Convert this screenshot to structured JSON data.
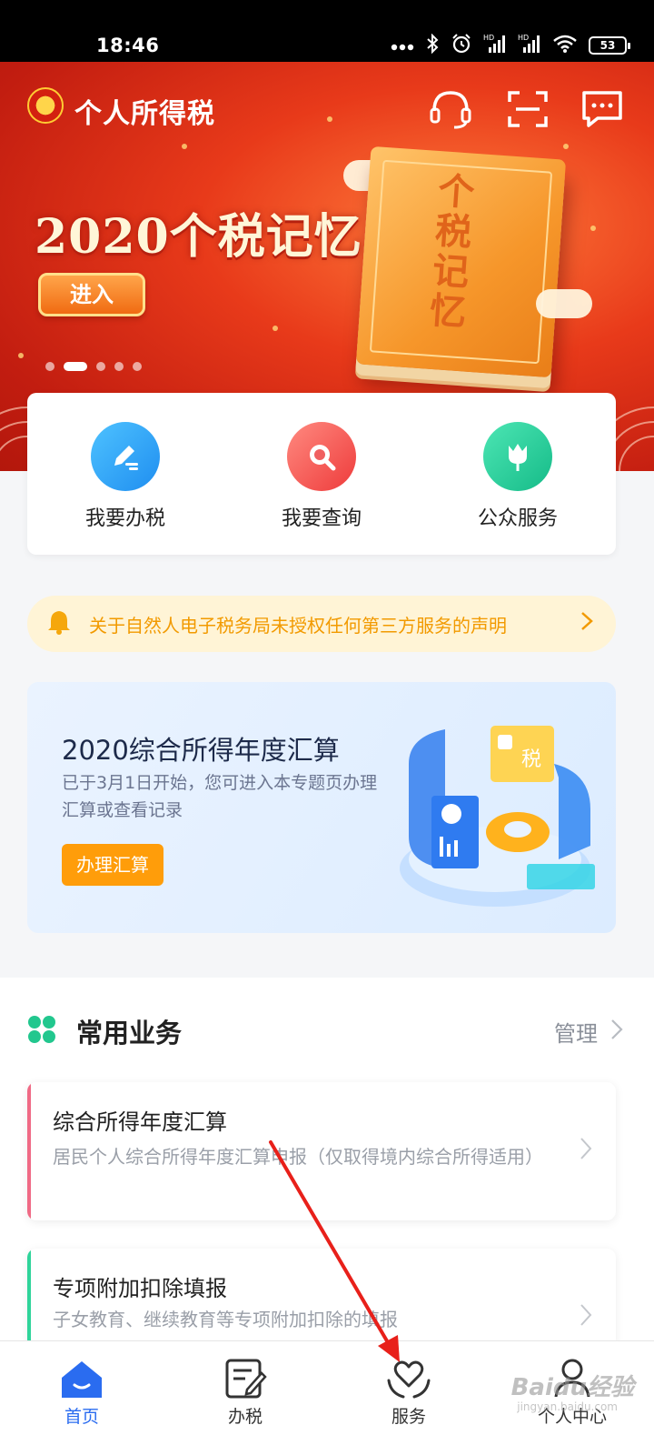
{
  "status_bar": {
    "time": "18:46",
    "battery": "53",
    "hd1": "HD",
    "hd2": "HD"
  },
  "header": {
    "app_title": "个人所得税"
  },
  "banner": {
    "title": "2020个税记忆",
    "enter_label": "进入",
    "book_text": "个税记忆",
    "page_count": 5,
    "active_page": 2
  },
  "quick_actions": [
    {
      "label": "我要办税",
      "icon": "edit-icon",
      "color": "#2aa3f5"
    },
    {
      "label": "我要查询",
      "icon": "search-icon",
      "color": "#f0494a"
    },
    {
      "label": "公众服务",
      "icon": "tulip-icon",
      "color": "#1ec995"
    }
  ],
  "notice": {
    "text": "关于自然人电子税务局未授权任何第三方服务的声明"
  },
  "annual": {
    "title": "2020综合所得年度汇算",
    "description": "已于3月1日开始，您可进入本专题页办理汇算或查看记录",
    "button": "办理汇算",
    "illus_label": "税"
  },
  "common": {
    "title": "常用业务",
    "manage": "管理",
    "items": [
      {
        "title": "综合所得年度汇算",
        "desc": "居民个人综合所得年度汇算申报（仅取得境内综合所得适用）",
        "accent": "#f06a85"
      },
      {
        "title": "专项附加扣除填报",
        "desc": "子女教育、继续教育等专项附加扣除的填报",
        "accent": "#2fd49a"
      }
    ]
  },
  "tabbar": [
    {
      "label": "首页",
      "icon": "home-icon",
      "active": true
    },
    {
      "label": "办税",
      "icon": "tax-form-icon",
      "active": false
    },
    {
      "label": "服务",
      "icon": "heart-hands-icon",
      "active": false
    },
    {
      "label": "个人中心",
      "icon": "person-icon",
      "active": false
    }
  ],
  "watermark": {
    "main": "Baidu经验",
    "sub": "jingyan.baidu.com"
  },
  "colors": {
    "brand_blue": "#2a6cf0",
    "banner_red": "#d8281a",
    "notice_orange": "#f29a00",
    "annotation_red": "#e8201a"
  }
}
